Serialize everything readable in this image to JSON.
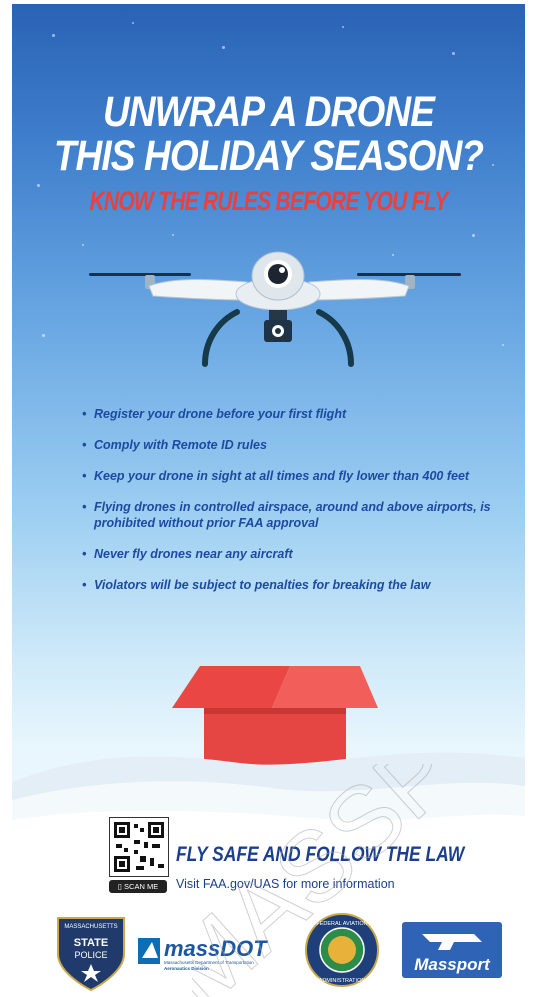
{
  "headline": {
    "line1": "UNWRAP A DRONE",
    "line2": "THIS HOLIDAY SEASON?"
  },
  "subheadline": "KNOW THE RULES BEFORE YOU FLY",
  "rules": [
    "Register your drone before your first flight",
    "Comply with Remote ID rules",
    "Keep your drone in sight at all times and fly lower than 400 feet",
    "Flying drones in controlled airspace, around and above airports, is prohibited without prior FAA approval",
    "Never fly drones near any aircraft",
    "Violators will be subject to penalties for breaking the law"
  ],
  "bullet": "•",
  "footer": {
    "scan_label": "SCAN ME",
    "tagline": "FLY SAFE AND FOLLOW THE LAW",
    "visit": "Visit FAA.gov/UAS for more information"
  },
  "logos": {
    "state_police": {
      "arc": "MASSACHUSETTS",
      "line1": "STATE",
      "line2": "POLICE"
    },
    "massdot": {
      "name": "massDOT",
      "line1": "Massachusetts Department of Transportation",
      "line2": "Aeronautics Division"
    },
    "faa": {
      "arc_top": "FEDERAL AVIATION",
      "arc_bottom": "ADMINISTRATION"
    },
    "massport": {
      "name": "Massport"
    }
  },
  "watermark": "MASSP",
  "colors": {
    "headline": "#ffffff",
    "subheadline": "#e8413f",
    "rules": "#1d4aa0",
    "footer_text": "#1c3f8c",
    "gift_box": "#ef4b47"
  },
  "icons": {
    "drone": "drone-icon",
    "gift": "gift-box-icon",
    "qr": "qr-code-icon",
    "phone": "phone-icon"
  }
}
